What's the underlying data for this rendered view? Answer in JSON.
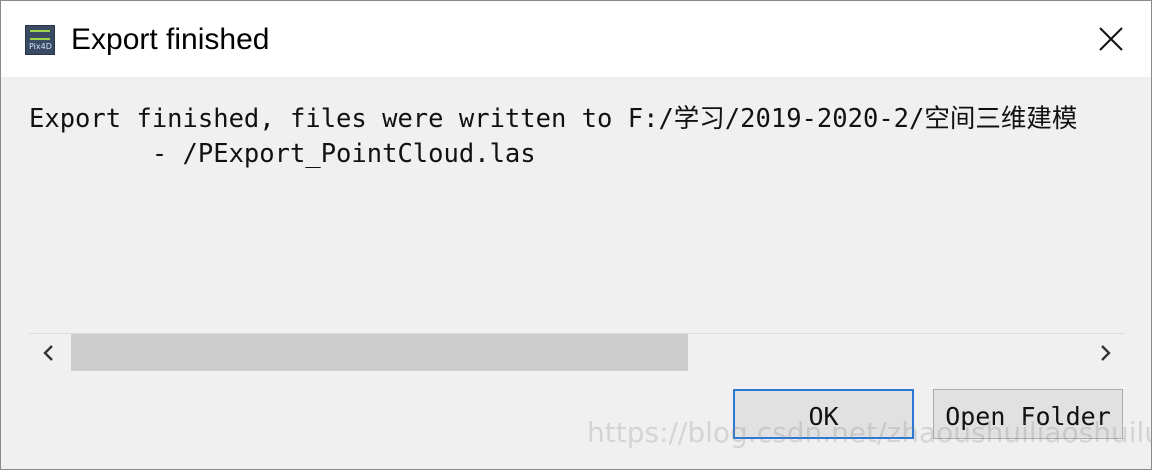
{
  "window": {
    "title": "Export finished",
    "app_icon_text": "Pix4D",
    "close_symbol": "×"
  },
  "message": {
    "line1": "Export finished, files were written to F:/学习/2019-2020-2/空间三维建模",
    "line2": "        - /PExport_PointCloud.las"
  },
  "scrollbar": {
    "left_arrow": "‹",
    "right_arrow": "›",
    "thumb_fraction": 0.61
  },
  "buttons": {
    "ok_label": "OK",
    "open_folder_label": "Open Folder"
  },
  "watermark": {
    "text": "https://blog.csdn.net/zhaoushuiliaoshuilu"
  },
  "colors": {
    "title_bar": "#ffffff",
    "dialog_bg": "#f0f0f0",
    "focus_border": "#2b78d6",
    "button_bg": "#e1e1e1"
  }
}
